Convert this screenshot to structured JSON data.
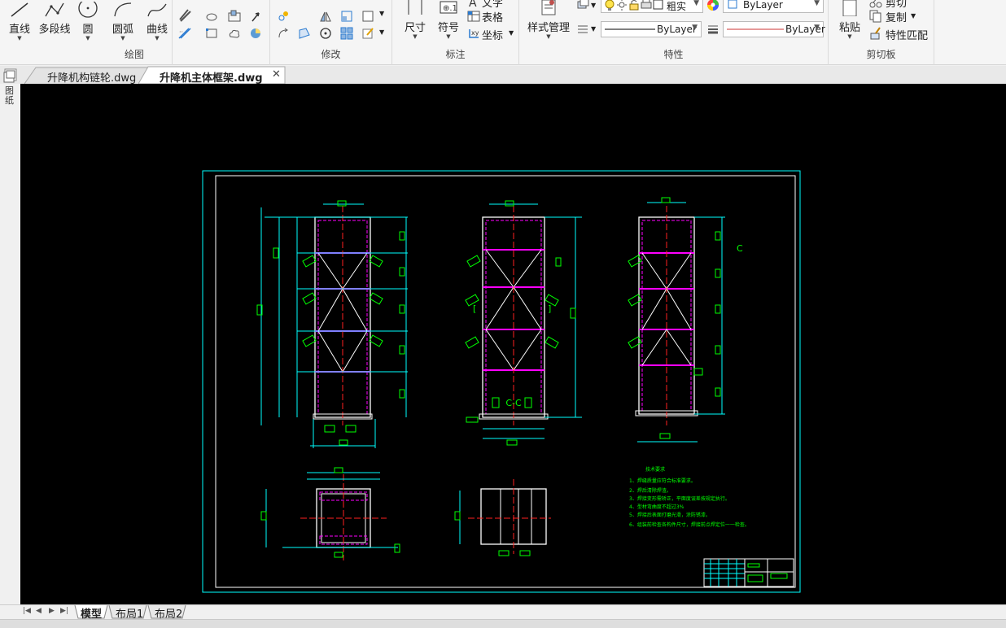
{
  "ribbon": {
    "draw": {
      "group_label": "绘图",
      "line": "直线",
      "polyline": "多段线",
      "circle": "圆",
      "arc": "圆弧",
      "curve": "曲线"
    },
    "modify": {
      "group_label": "修改"
    },
    "annotate": {
      "group_label": "标注",
      "dimension": "尺寸",
      "symbol": "符号",
      "text": "文字",
      "table": "表格",
      "coord": "坐标"
    },
    "properties": {
      "group_label": "特性",
      "style_manager": "样式管理",
      "layer_name": "粗实",
      "color_value": "ByLayer",
      "linetype_value": "ByLayer",
      "lineweight_value": "ByLayer"
    },
    "clipboard": {
      "group_label": "剪切板",
      "paste": "粘贴",
      "cut": "剪切",
      "copy": "复制",
      "match_props": "特性匹配"
    }
  },
  "file_tabs": [
    {
      "label": "升降机构链轮.dwg",
      "active": false
    },
    {
      "label": "升降机主体框架.dwg",
      "active": true
    }
  ],
  "side_panel_label": "图纸",
  "drawing": {
    "section_label": "C-C",
    "view_label": "C",
    "notes_title": "技术要求",
    "notes": [
      "1、焊缝质量应符合标准要求。",
      "2、焊后清除焊渣。",
      "3、焊接变形需矫正，平面度误差按规定执行。",
      "4、型材弯曲度不超过3%",
      "5、焊接后表面打磨光滑，涂防锈漆。",
      "6、组装前检查各构件尺寸，焊接前点焊定位一一检查。"
    ]
  },
  "layout_tabs": [
    {
      "label": "模型",
      "active": true
    },
    {
      "label": "布局1",
      "active": false
    },
    {
      "label": "布局2",
      "active": false
    }
  ],
  "colors": {
    "canvas": "#000000",
    "border": "#00ffff",
    "frame": "#ffffff",
    "dims": "#00ff00",
    "center": "#ff2020",
    "hidden": "#ff00ff",
    "structure": "#ffffff",
    "accent_line": "#cc3333"
  }
}
